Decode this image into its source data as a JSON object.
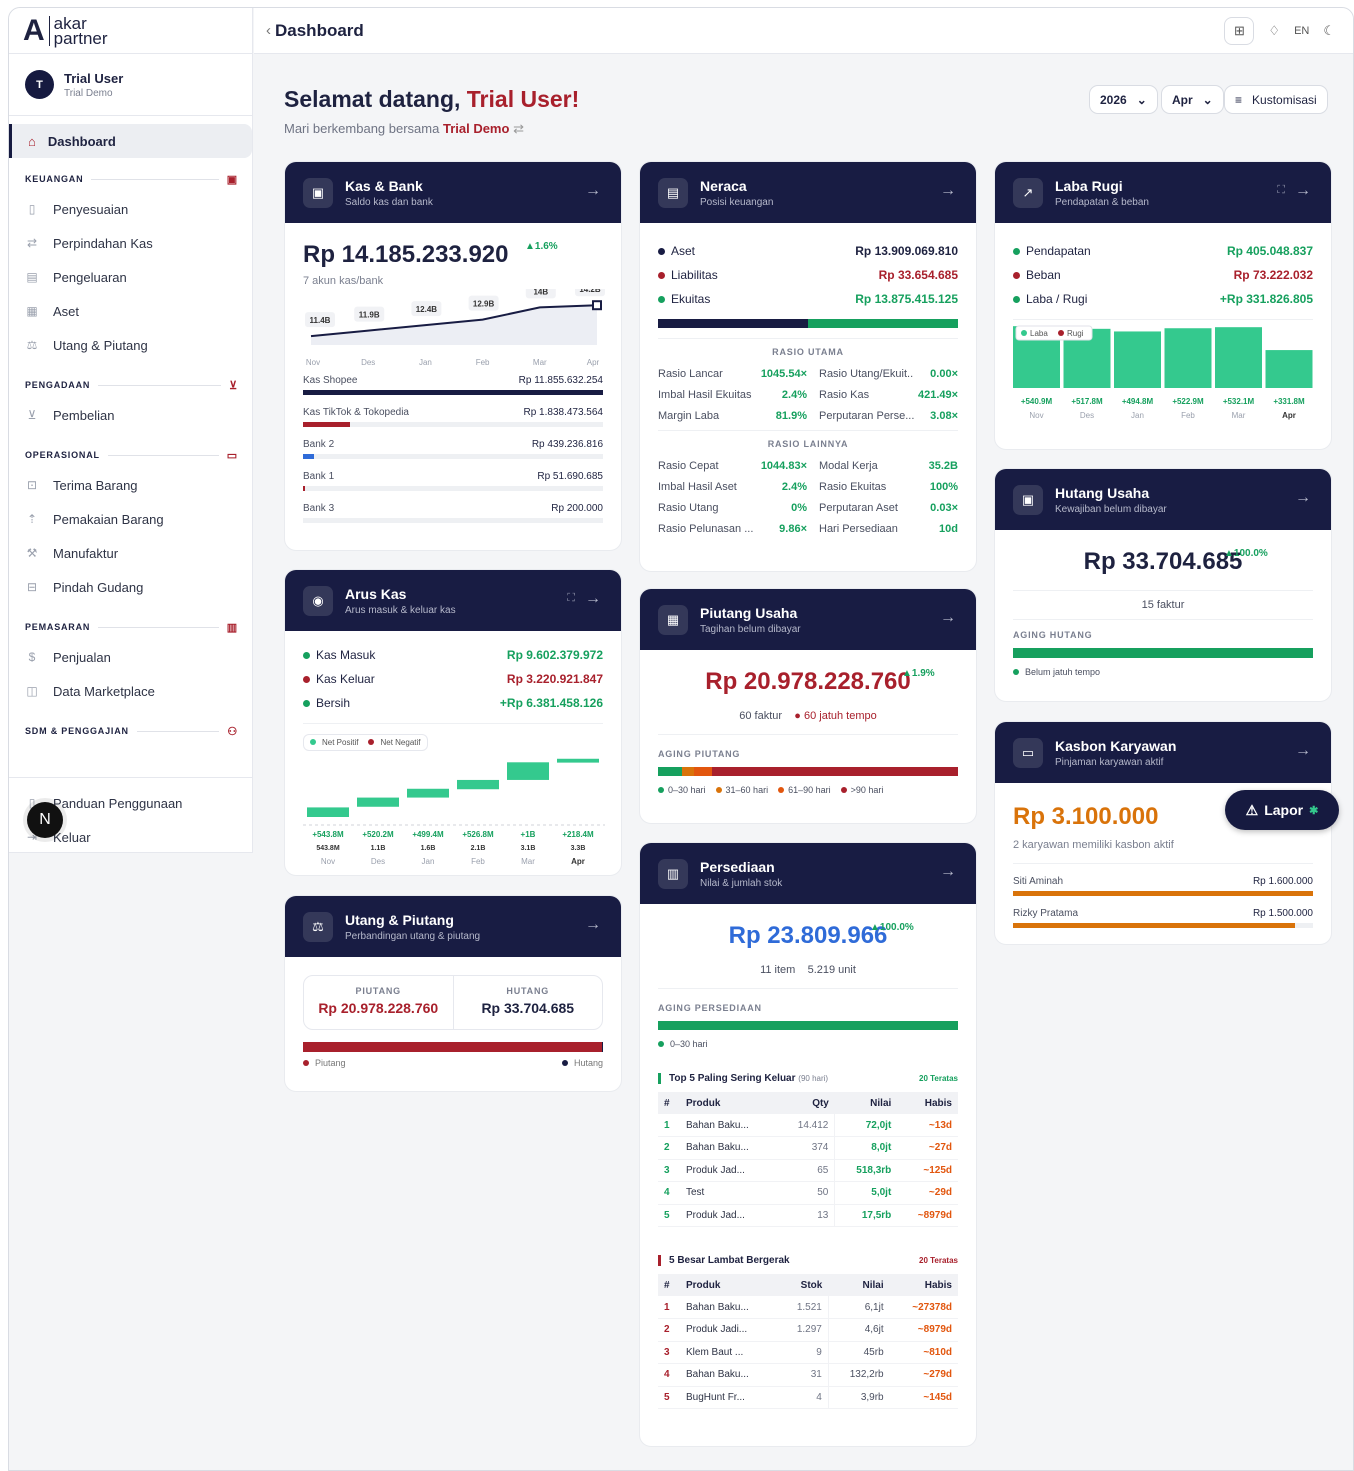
{
  "brand": {
    "line1": "akar",
    "line2": "partner"
  },
  "user": {
    "initial": "T",
    "name": "Trial User",
    "org": "Trial Demo"
  },
  "sidebar": {
    "active": "Dashboard",
    "sections": [
      {
        "title": "KEUANGAN",
        "items": [
          "Penyesuaian",
          "Perpindahan Kas",
          "Pengeluaran",
          "Aset",
          "Utang & Piutang"
        ]
      },
      {
        "title": "PENGADAAN",
        "items": [
          "Pembelian"
        ]
      },
      {
        "title": "OPERASIONAL",
        "items": [
          "Terima Barang",
          "Pemakaian Barang",
          "Manufaktur",
          "Pindah Gudang"
        ]
      },
      {
        "title": "PEMASARAN",
        "items": [
          "Penjualan",
          "Data Marketplace"
        ]
      },
      {
        "title": "SDM & PENGGAJIAN",
        "items": []
      }
    ],
    "footer": [
      "Panduan Penggunaan",
      "Keluar"
    ]
  },
  "topbar": {
    "title": "Dashboard",
    "lang": "EN"
  },
  "header": {
    "greeting": "Selamat datang, ",
    "name": "Trial User!",
    "sub": "Mari berkembang bersama ",
    "org": "Trial Demo",
    "year": "2026",
    "month": "Apr",
    "customize": "Kustomisasi"
  },
  "kas": {
    "title": "Kas & Bank",
    "sub": "Saldo kas dan bank",
    "total": "Rp 14.185.233.920",
    "pct": "▲1.6%",
    "accounts_note": "7 akun kas/bank",
    "chart_data": {
      "type": "area",
      "x": [
        "Nov",
        "Des",
        "Jan",
        "Feb",
        "Mar",
        "Apr"
      ],
      "values": [
        11.4,
        11.9,
        12.4,
        12.9,
        14,
        14.2
      ],
      "labels": [
        "11.4B",
        "11.9B",
        "12.4B",
        "12.9B",
        "14B",
        "14.2B"
      ],
      "ylabel": "",
      "xlabel": ""
    },
    "accounts": [
      {
        "name": "Kas Shopee",
        "value": "Rp 11.855.632.254",
        "share": 1.0,
        "color": "#181c43"
      },
      {
        "name": "Kas TikTok & Tokopedia",
        "value": "Rp 1.838.473.564",
        "share": 0.155,
        "color": "#a8202c"
      },
      {
        "name": "Bank 2",
        "value": "Rp 439.236.816",
        "share": 0.037,
        "color": "#2f6bd8"
      },
      {
        "name": "Bank 1",
        "value": "Rp 51.690.685",
        "share": 0.004,
        "color": "#a8202c"
      },
      {
        "name": "Bank 3",
        "value": "Rp 200.000",
        "share": 0.0,
        "color": "#181c43"
      }
    ]
  },
  "arus": {
    "title": "Arus Kas",
    "sub": "Arus masuk & keluar kas",
    "rows": [
      {
        "label": "Kas Masuk",
        "value": "Rp 9.602.379.972"
      },
      {
        "label": "Kas Keluar",
        "value": "Rp 3.220.921.847"
      },
      {
        "label": "Bersih",
        "value": "+Rp 6.381.458.126"
      }
    ],
    "legend": [
      "Net Positif",
      "Net Negatif"
    ],
    "chart_data": {
      "type": "bar",
      "x": [
        "Nov",
        "Des",
        "Jan",
        "Feb",
        "Mar",
        "Apr"
      ],
      "net": [
        0.5438,
        0.5202,
        0.4994,
        0.5268,
        1.0,
        0.2184
      ],
      "cumulative": [
        0.5438,
        1.1,
        1.6,
        2.1,
        3.1,
        3.3
      ],
      "net_labels": [
        "+543.8M",
        "+520.2M",
        "+499.4M",
        "+526.8M",
        "+1B",
        "+218.4M"
      ],
      "cum_labels": [
        "543.8M",
        "1.1B",
        "1.6B",
        "2.1B",
        "3.1B",
        "3.3B"
      ]
    }
  },
  "up": {
    "title": "Utang & Piutang",
    "sub": "Perbandingan utang & piutang",
    "piutang_label": "PIUTANG",
    "piutang": "Rp 20.978.228.760",
    "hutang_label": "HUTANG",
    "hutang": "Rp 33.704.685",
    "piutang_share": 0.998,
    "legend": [
      "Piutang",
      "Hutang"
    ]
  },
  "neraca": {
    "title": "Neraca",
    "sub": "Posisi keuangan",
    "rows": [
      {
        "label": "Aset",
        "value": "Rp 13.909.069.810"
      },
      {
        "label": "Liabilitas",
        "value": "Rp 33.654.685"
      },
      {
        "label": "Ekuitas",
        "value": "Rp 13.875.415.125"
      }
    ],
    "utama_title": "RASIO UTAMA",
    "utama": [
      [
        "Rasio Lancar",
        "1045.54×",
        "Rasio Utang/Ekuit...",
        "0.00×"
      ],
      [
        "Imbal Hasil Ekuitas",
        "2.4%",
        "Rasio Kas",
        "421.49×"
      ],
      [
        "Margin Laba",
        "81.9%",
        "Perputaran Perse...",
        "3.08×"
      ]
    ],
    "lain_title": "RASIO LAINNYA",
    "lain": [
      [
        "Rasio Cepat",
        "1044.83×",
        "Modal Kerja",
        "35.2B"
      ],
      [
        "Imbal Hasil Aset",
        "2.4%",
        "Rasio Ekuitas",
        "100%"
      ],
      [
        "Rasio Utang",
        "0%",
        "Perputaran Aset",
        "0.03×"
      ],
      [
        "Rasio Pelunasan ...",
        "9.86×",
        "Hari Persediaan",
        "10d"
      ]
    ]
  },
  "piutang": {
    "title": "Piutang Usaha",
    "sub": "Tagihan belum dibayar",
    "total": "Rp 20.978.228.760",
    "pct": "▲1.9%",
    "count": "60 faktur",
    "due": "60 jatuh tempo",
    "aging_title": "AGING PIUTANG",
    "aging": [
      [
        "0–30 hari",
        0.08
      ],
      [
        "31–60 hari",
        0.04
      ],
      [
        "61–90 hari",
        0.06
      ],
      [
        ">90 hari",
        0.82
      ]
    ]
  },
  "persediaan": {
    "title": "Persediaan",
    "sub": "Nilai & jumlah stok",
    "total": "Rp 23.809.966",
    "pct": "▲100.0%",
    "items": "11 item",
    "units": "5.219 unit",
    "aging_title": "AGING PERSEDIAAN",
    "aging_legend": "0–30 hari",
    "top_title": "Top 5 Paling Sering Keluar",
    "top_period": "(90 hari)",
    "top_link": "20 Teratas",
    "top_head": [
      "#",
      "Produk",
      "Qty",
      "Nilai",
      "Habis"
    ],
    "top_rows": [
      [
        "1",
        "Bahan Baku...",
        "14.412",
        "72,0jt",
        "~13d"
      ],
      [
        "2",
        "Bahan Baku...",
        "374",
        "8,0jt",
        "~27d"
      ],
      [
        "3",
        "Produk Jad...",
        "65",
        "518,3rb",
        "~125d"
      ],
      [
        "4",
        "Test",
        "50",
        "5,0jt",
        "~29d"
      ],
      [
        "5",
        "Produk Jad...",
        "13",
        "17,5rb",
        "~8979d"
      ]
    ],
    "slow_title": "5 Besar Lambat Bergerak",
    "slow_link": "20 Teratas",
    "slow_head": [
      "#",
      "Produk",
      "Stok",
      "Nilai",
      "Habis"
    ],
    "slow_rows": [
      [
        "1",
        "Bahan Baku...",
        "1.521",
        "6,1jt",
        "~27378d"
      ],
      [
        "2",
        "Produk Jadi...",
        "1.297",
        "4,6jt",
        "~8979d"
      ],
      [
        "3",
        "Klem Baut ...",
        "9",
        "45rb",
        "~810d"
      ],
      [
        "4",
        "Bahan Baku...",
        "31",
        "132,2rb",
        "~279d"
      ],
      [
        "5",
        "BugHunt Fr...",
        "4",
        "3,9rb",
        "~145d"
      ]
    ]
  },
  "laba": {
    "title": "Laba Rugi",
    "sub": "Pendapatan & beban",
    "rows": [
      {
        "label": "Pendapatan",
        "value": "Rp 405.048.837"
      },
      {
        "label": "Beban",
        "value": "Rp 73.222.032"
      },
      {
        "label": "Laba / Rugi",
        "value": "+Rp 331.826.805"
      }
    ],
    "legend": [
      "Laba",
      "Rugi"
    ],
    "chart_data": {
      "type": "bar",
      "x": [
        "Nov",
        "Des",
        "Jan",
        "Feb",
        "Mar",
        "Apr"
      ],
      "values": [
        540.9,
        517.8,
        494.8,
        522.9,
        532.1,
        331.8
      ],
      "labels": [
        "+540.9M",
        "+517.8M",
        "+494.8M",
        "+522.9M",
        "+532.1M",
        "+331.8M"
      ]
    }
  },
  "hutang": {
    "title": "Hutang Usaha",
    "sub": "Kewajiban belum dibayar",
    "total": "Rp 33.704.685",
    "pct": "▲100.0%",
    "count": "15 faktur",
    "aging_title": "AGING HUTANG",
    "aging_legend": "Belum jatuh tempo"
  },
  "kasbon": {
    "title": "Kasbon Karyawan",
    "sub": "Pinjaman karyawan aktif",
    "total": "Rp 3.100.000",
    "note": "2 karyawan memiliki kasbon aktif",
    "rows": [
      {
        "name": "Siti Aminah",
        "value": "Rp 1.600.000",
        "share": 1.0
      },
      {
        "name": "Rizky Pratama",
        "value": "Rp 1.500.000",
        "share": 0.94
      }
    ]
  },
  "lapor": "Lapor",
  "colors": {
    "navy": "#181c43",
    "red": "#a8202c",
    "green": "#16a05e",
    "mint": "#34c98e",
    "orange": "#d9730a"
  }
}
